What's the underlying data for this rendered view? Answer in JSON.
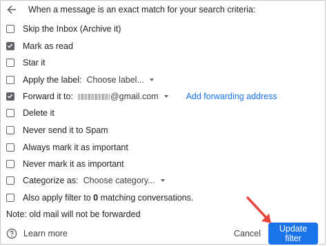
{
  "header": {
    "text": "When a message is an exact match for your search criteria:"
  },
  "options": {
    "skip_inbox": {
      "label": "Skip the Inbox (Archive it)",
      "checked": false
    },
    "mark_read": {
      "label": "Mark as read",
      "checked": true
    },
    "star": {
      "label": "Star it",
      "checked": false
    },
    "apply_label": {
      "label": "Apply the label:",
      "checked": false,
      "dropdown": "Choose label..."
    },
    "forward": {
      "label": "Forward it to:",
      "checked": true,
      "email_suffix": "@gmail.com",
      "link": "Add forwarding address"
    },
    "delete": {
      "label": "Delete it",
      "checked": false
    },
    "never_spam": {
      "label": "Never send it to Spam",
      "checked": false
    },
    "always_important": {
      "label": "Always mark it as important",
      "checked": false
    },
    "never_important": {
      "label": "Never mark it as important",
      "checked": false
    },
    "categorize": {
      "label": "Categorize as:",
      "checked": false,
      "dropdown": "Choose category..."
    },
    "also_apply": {
      "label_prefix": "Also apply filter to ",
      "count": "0",
      "label_suffix": " matching conversations.",
      "checked": false
    }
  },
  "note": "Note: old mail will not be forwarded",
  "footer": {
    "learn_more": "Learn more",
    "cancel": "Cancel",
    "update": "Update filter"
  },
  "colors": {
    "accent": "#1a73e8",
    "arrow": "#e8453c",
    "checkbox": "#5f6368"
  },
  "icons": {
    "back": "arrow-left-icon",
    "help": "help-circle-icon",
    "annotation": "red-arrow"
  }
}
